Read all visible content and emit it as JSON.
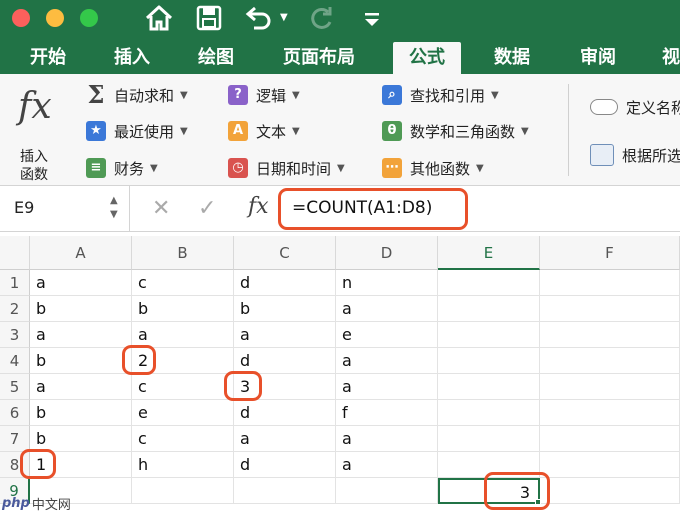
{
  "window": {
    "close_glyph": "×",
    "minimize_glyph": "−",
    "zoom_glyph": "+"
  },
  "toolbar": {
    "icons": [
      "home-icon",
      "save-icon",
      "undo-icon",
      "redo-icon",
      "customize-icon"
    ]
  },
  "tabs": [
    {
      "label": "开始"
    },
    {
      "label": "插入"
    },
    {
      "label": "绘图"
    },
    {
      "label": "页面布局"
    },
    {
      "label": "公式",
      "active": true
    },
    {
      "label": "数据"
    },
    {
      "label": "审阅"
    },
    {
      "label": "视"
    }
  ],
  "ribbon": {
    "insert_function": {
      "line1": "插入",
      "line2": "函数"
    },
    "col1": [
      {
        "label": "自动求和",
        "icon": "sigma-icon"
      },
      {
        "label": "最近使用",
        "icon": "star-icon"
      },
      {
        "label": "财务",
        "icon": "coins-icon"
      }
    ],
    "col2": [
      {
        "label": "逻辑",
        "icon": "logic-icon"
      },
      {
        "label": "文本",
        "icon": "text-icon"
      },
      {
        "label": "日期和时间",
        "icon": "calendar-icon"
      }
    ],
    "col3": [
      {
        "label": "查找和引用",
        "icon": "lookup-icon"
      },
      {
        "label": "数学和三角函数",
        "icon": "theta-icon"
      },
      {
        "label": "其他函数",
        "icon": "more-functions-icon"
      }
    ],
    "col4": [
      {
        "label": "定义名称",
        "icon": "define-name-icon"
      },
      {
        "label": "根据所选",
        "icon": "create-from-selection-icon"
      }
    ],
    "colors": {
      "blue": "#3b78d8",
      "purple": "#8a62c9",
      "orange": "#f2a33a",
      "green": "#4f9a55",
      "red": "#d9534f",
      "teal": "#2e8b7a"
    }
  },
  "formula_bar": {
    "name_box": "E9",
    "cancel": "✕",
    "enter": "✓",
    "fx": "fx",
    "formula": "=COUNT(A1:D8)"
  },
  "sheet": {
    "columns": [
      "A",
      "B",
      "C",
      "D",
      "E",
      "F"
    ],
    "rows": [
      [
        "a",
        "c",
        "d",
        "n"
      ],
      [
        "b",
        "b",
        "b",
        "a"
      ],
      [
        "a",
        "a",
        "a",
        "e"
      ],
      [
        "b",
        "2",
        "d",
        "a"
      ],
      [
        "a",
        "c",
        "3",
        "a"
      ],
      [
        "b",
        "e",
        "d",
        "f"
      ],
      [
        "b",
        "c",
        "a",
        "a"
      ],
      [
        "1",
        "h",
        "d",
        "a"
      ]
    ],
    "row_numbers": [
      "1",
      "2",
      "3",
      "4",
      "5",
      "6",
      "7",
      "8",
      "9"
    ],
    "result_cell": "3",
    "selected_cell": "E9"
  },
  "watermark": {
    "php": "php",
    "text": "中文网"
  },
  "accent": "#217346",
  "highlight_color": "#e8502a"
}
